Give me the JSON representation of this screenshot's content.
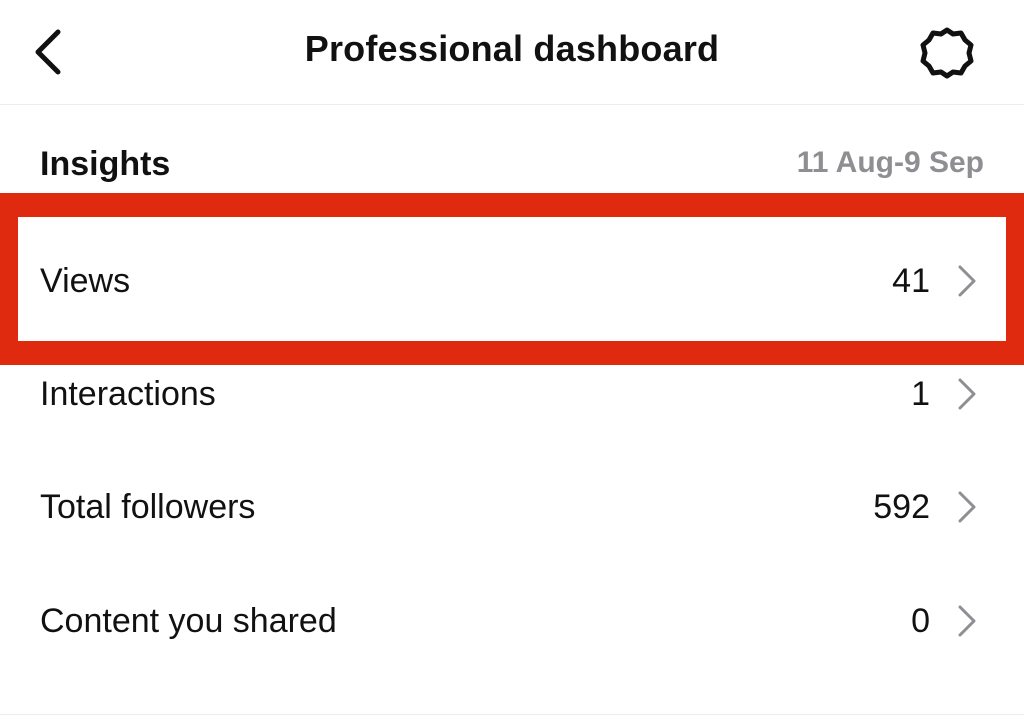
{
  "header": {
    "title": "Professional dashboard",
    "back_icon": "chevron-left-icon",
    "settings_icon": "gear-icon"
  },
  "insights": {
    "title": "Insights",
    "date_range": "11 Aug-9 Sep",
    "rows": [
      {
        "label": "Views",
        "value": "41"
      },
      {
        "label": "Interactions",
        "value": "1"
      },
      {
        "label": "Total followers",
        "value": "592"
      },
      {
        "label": "Content you shared",
        "value": "0"
      }
    ]
  },
  "colors": {
    "highlight": "#e02a10",
    "muted_text": "#8e8e93",
    "primary_text": "#111111"
  }
}
